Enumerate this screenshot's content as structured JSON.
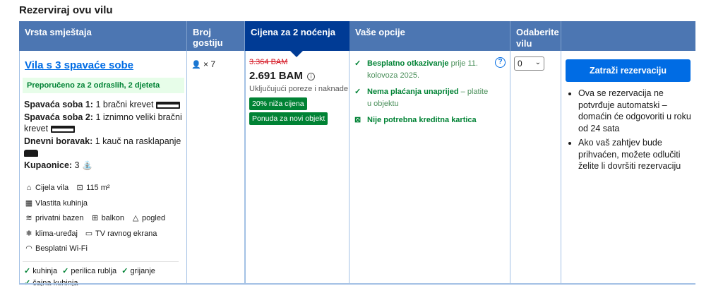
{
  "page_title": "Rezerviraj ovu vilu",
  "header": {
    "type": "Vrsta smještaja",
    "guests": "Broj gostiju",
    "price": "Cijena za 2 noćenja",
    "options": "Vaše opcije",
    "select": "Odaberite vilu",
    "action": ""
  },
  "room": {
    "name": "Vila s 3 spavaće sobe",
    "recommended": "Preporučeno za 2 odraslih, 2 djeteta",
    "beds": [
      {
        "label": "Spavaća soba 1:",
        "value": "1 bračni krevet",
        "icon": "bed-icon"
      },
      {
        "label": "Spavaća soba 2:",
        "value": "1 iznimno veliki bračni krevet",
        "icon": "bed-icon"
      },
      {
        "label": "Dnevni boravak:",
        "value": "1 kauč na rasklapanje",
        "icon": "sofa-icon"
      },
      {
        "label": "Kupaonice:",
        "value": "3",
        "icon": "bath-icon"
      }
    ],
    "facilities": [
      {
        "label": "Cijela vila",
        "icon": "house-icon"
      },
      {
        "label": "115 m²",
        "icon": "area-icon"
      },
      {
        "label": "Vlastita kuhinja",
        "icon": "kitchen-icon"
      },
      {
        "label": "privatni bazen",
        "icon": "pool-icon"
      },
      {
        "label": "balkon",
        "icon": "balcony-icon"
      },
      {
        "label": "pogled",
        "icon": "view-icon"
      },
      {
        "label": "klima-uređaj",
        "icon": "snowflake-icon"
      },
      {
        "label": "TV ravnog ekrana",
        "icon": "tv-icon"
      },
      {
        "label": "Besplatni Wi-Fi",
        "icon": "wifi-icon"
      }
    ],
    "checks": [
      "kuhinja",
      "perilica rublja",
      "grijanje",
      "čajna kuhinja"
    ]
  },
  "guests": {
    "count": "× 7",
    "icon": "person-icon"
  },
  "price": {
    "old": "3.364 BAM",
    "new": "2.691 BAM",
    "tax_note": "Uključujući poreze i naknade",
    "discount_badge": "20% niža cijena",
    "new_property_badge": "Ponuda za novi objekt"
  },
  "options": {
    "cancellation_bold": "Besplatno otkazivanje",
    "cancellation_rest": "prije 11. kolovoza 2025.",
    "no_prepay_bold": "Nema plaćanja unaprijed",
    "no_prepay_rest": "– platite u objektu",
    "no_card": "Nije potrebna kreditna kartica"
  },
  "select": {
    "value": "0"
  },
  "action": {
    "button": "Zatraži rezervaciju",
    "notes": [
      "Ova se rezervacija ne potvrđuje automatski – domaćin će odgovoriti u roku od 24 sata",
      "Ako vaš zahtjev bude prihvaćen, možete odlučiti želite li dovršiti rezervaciju"
    ]
  },
  "colors": {
    "header": "#4c76b2",
    "header_active": "#003b95",
    "green": "#008234",
    "blue": "#006ce4",
    "red": "#d4111e"
  }
}
